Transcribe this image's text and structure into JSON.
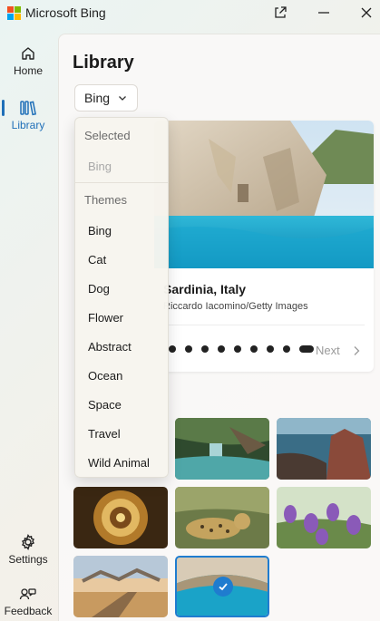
{
  "app": {
    "title": "Microsoft Bing"
  },
  "colors": {
    "accent": "#1f6fb8",
    "selected_border": "#1f7ccf",
    "logo": [
      "#f25022",
      "#7fba00",
      "#00a4ef",
      "#ffb900"
    ]
  },
  "titlebar": {
    "buttons": [
      {
        "name": "share-button",
        "icon": "share-icon"
      },
      {
        "name": "minimize-button",
        "icon": "minimize-icon"
      },
      {
        "name": "close-button",
        "icon": "close-icon"
      }
    ]
  },
  "nav": {
    "home": {
      "label": "Home",
      "icon": "home-icon"
    },
    "library": {
      "label": "Library",
      "icon": "library-icon",
      "active": true
    },
    "settings": {
      "label": "Settings",
      "icon": "gear-icon"
    },
    "feedback": {
      "label": "Feedback",
      "icon": "feedback-icon"
    }
  },
  "page": {
    "title": "Library",
    "filter": {
      "value": "Bing"
    }
  },
  "dropdown": {
    "selected_header": "Selected",
    "selected_value": "Bing",
    "themes_header": "Themes",
    "themes": [
      "Bing",
      "Cat",
      "Dog",
      "Flower",
      "Abstract",
      "Ocean",
      "Space",
      "Travel",
      "Wild Animal"
    ]
  },
  "featured": {
    "title": "Sardinia, Italy",
    "credit": "Riccardo Iacomino/Getty Images",
    "dot_count": 9,
    "active_dot": 8,
    "next_label": "Next"
  },
  "thumbnails": [
    {
      "name": "thumb-waterfall",
      "selected": false
    },
    {
      "name": "thumb-rocky-coast",
      "selected": false
    },
    {
      "name": "thumb-dome-ceiling",
      "selected": false
    },
    {
      "name": "thumb-leopard",
      "selected": false
    },
    {
      "name": "thumb-purple-flowers",
      "selected": false
    },
    {
      "name": "thumb-boardwalk",
      "selected": false
    },
    {
      "name": "thumb-sea-cave",
      "selected": true
    }
  ]
}
